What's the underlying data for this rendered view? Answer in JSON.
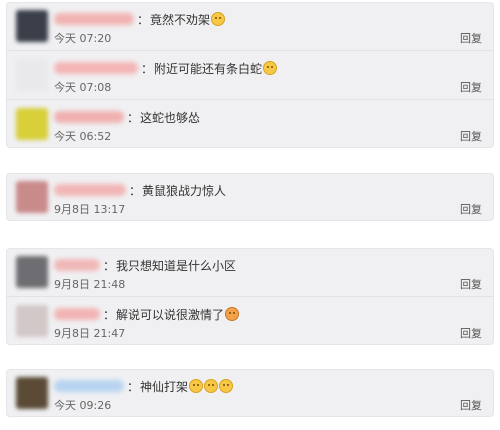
{
  "groups": [
    {
      "comments": [
        {
          "separator": "：",
          "text": "竟然不劝架",
          "emojis": [
            "grin-emoji"
          ],
          "time": "今天 07:20",
          "reply": "回复",
          "avatar_color": "#3b3f4a",
          "name_color": "#f2b3b3"
        },
        {
          "separator": "：",
          "text": "附近可能还有条白蛇",
          "emojis": [
            "cat-face-emoji"
          ],
          "time": "今天 07:08",
          "reply": "回复",
          "avatar_color": "#e9e9ec",
          "name_color": "#f4b5b5"
        },
        {
          "separator": "：",
          "text": "这蛇也够怂",
          "emojis": [],
          "time": "今天 06:52",
          "reply": "回复",
          "avatar_color": "#d8cf3a",
          "name_color": "#f0b0b0"
        }
      ]
    },
    {
      "comments": [
        {
          "separator": "：",
          "text": "黄鼠狼战力惊人",
          "emojis": [],
          "time": "9月8日 13:17",
          "reply": "回复",
          "avatar_color": "#c98a8a",
          "name_color": "#f2b6b6"
        }
      ]
    },
    {
      "comments": [
        {
          "separator": "：",
          "text": "我只想知道是什么小区",
          "emojis": [],
          "time": "9月8日 21:48",
          "reply": "回复",
          "avatar_color": "#6e6e72",
          "name_color": "#f0b8b8"
        },
        {
          "separator": "：",
          "text": "解说可以说很激情了",
          "emojis": [
            "cat-emoji"
          ],
          "time": "9月8日 21:47",
          "reply": "回复",
          "avatar_color": "#d2c8c8",
          "name_color": "#f2b4b4"
        }
      ]
    },
    {
      "comments": [
        {
          "separator": "：",
          "text": "神仙打架",
          "emojis": [
            "cat-face-emoji",
            "cat-face-emoji",
            "cat-face-emoji"
          ],
          "time": "今天 09:26",
          "reply": "回复",
          "avatar_color": "#5a4a36",
          "name_color": "#b7d3f0"
        }
      ]
    }
  ]
}
